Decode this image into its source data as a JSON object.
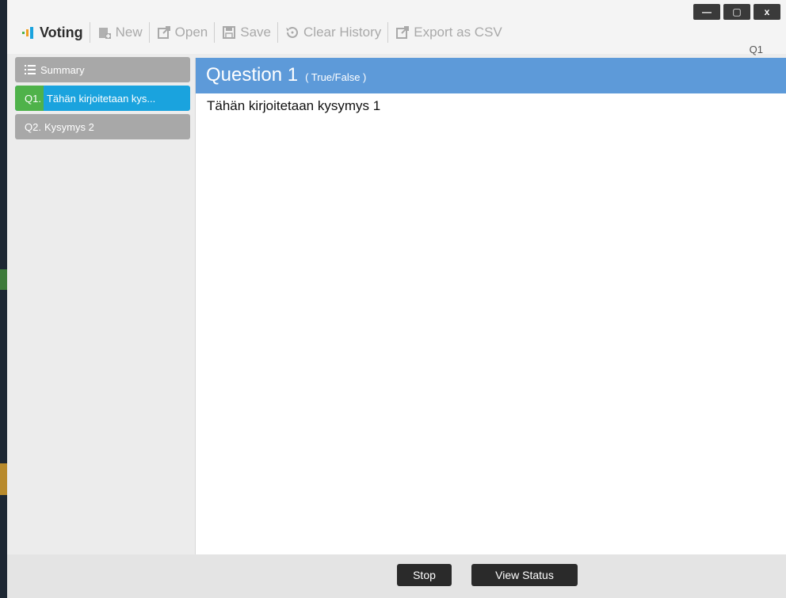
{
  "toolbar": {
    "brand": "Voting",
    "new_label": "New",
    "open_label": "Open",
    "save_label": "Save",
    "clear_history_label": "Clear History",
    "export_label": "Export as CSV"
  },
  "question_indicator": "Q1",
  "window_controls": {
    "minimize": "—",
    "maximize": "▢",
    "close": "x"
  },
  "sidebar": {
    "items": [
      {
        "label": "Summary",
        "icon": "list-icon"
      },
      {
        "num": "Q1.",
        "label": "Tähän kirjoitetaan kys...",
        "active": true
      },
      {
        "num": "Q2.",
        "label": "Kysymys 2"
      }
    ]
  },
  "question": {
    "title": "Question 1",
    "type": "( True/False )",
    "text": "Tähän kirjoitetaan kysymys 1"
  },
  "footer": {
    "stop_label": "Stop",
    "view_status_label": "View Status"
  },
  "colors": {
    "header_blue": "#5d9ad9",
    "active_item": "#1aa3de",
    "qnum_green": "#4fb24a",
    "inactive_item": "#a8a8a8"
  }
}
